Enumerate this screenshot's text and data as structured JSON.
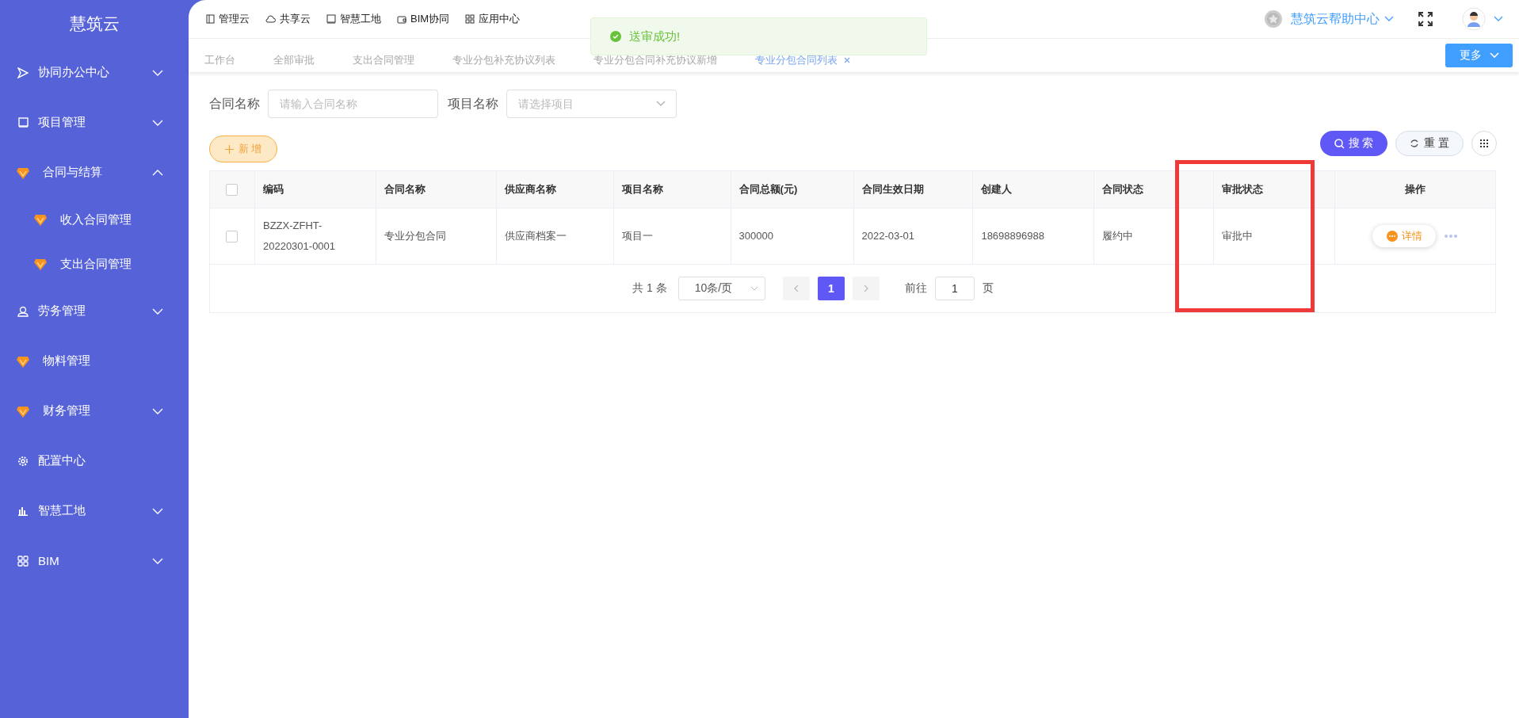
{
  "sidebar": {
    "logo": "慧筑云",
    "items": [
      {
        "label": "协同办公中心",
        "kind": "send",
        "expanded": false
      },
      {
        "label": "项目管理",
        "kind": "book",
        "expanded": false
      },
      {
        "label": "合同与结算",
        "kind": "gem",
        "expanded": true,
        "children": [
          {
            "label": "收入合同管理"
          },
          {
            "label": "支出合同管理"
          }
        ]
      },
      {
        "label": "劳务管理",
        "kind": "user",
        "expanded": false
      },
      {
        "label": "物料管理",
        "kind": "gem"
      },
      {
        "label": "财务管理",
        "kind": "gem",
        "expanded": false
      },
      {
        "label": "配置中心",
        "kind": "gear"
      },
      {
        "label": "智慧工地",
        "kind": "chart",
        "expanded": false
      },
      {
        "label": "BIM",
        "kind": "grid",
        "expanded": false
      }
    ]
  },
  "top_nav": [
    {
      "label": "管理云",
      "kind": "panel"
    },
    {
      "label": "共享云",
      "kind": "cloud"
    },
    {
      "label": "智慧工地",
      "kind": "book"
    },
    {
      "label": "BIM协同",
      "kind": "wallet"
    },
    {
      "label": "应用中心",
      "kind": "grid"
    }
  ],
  "help": {
    "label": "慧筑云帮助中心"
  },
  "tabs": [
    {
      "label": "工作台",
      "selected": false,
      "closable": false
    },
    {
      "label": "全部审批",
      "selected": false,
      "closable": false
    },
    {
      "label": "支出合同管理",
      "selected": false,
      "closable": false
    },
    {
      "label": "专业分包补充协议列表",
      "selected": false,
      "closable": false
    },
    {
      "label": "专业分包合同补充协议新增",
      "selected": false,
      "closable": false
    },
    {
      "label": "专业分包合同列表",
      "selected": true,
      "closable": true
    }
  ],
  "more_button": "更多",
  "toast": {
    "message": "送审成功!"
  },
  "filters": [
    {
      "label": "合同名称",
      "kind": "input",
      "placeholder": "请输入合同名称"
    },
    {
      "label": "项目名称",
      "kind": "select",
      "placeholder": "请选择项目"
    }
  ],
  "add_button": "新 增",
  "search_button": "搜 索",
  "reset_button": "重 置",
  "table": {
    "all_checked": false,
    "columns": [
      "编码",
      "合同名称",
      "供应商名称",
      "项目名称",
      "合同总额(元)",
      "合同生效日期",
      "创建人",
      "合同状态",
      "审批状态",
      "操作"
    ],
    "rows": [
      {
        "checked": false,
        "cells": [
          "BZZX-ZFHT-20220301-0001",
          "专业分包合同",
          "供应商档案一",
          "项目一",
          "300000",
          "2022-03-01",
          "18698896988",
          "履约中",
          "审批中"
        ],
        "action": "详情"
      }
    ]
  },
  "pagination": {
    "total": "共 1 条",
    "page_size": "10条/页",
    "pages": [
      {
        "label": "1",
        "selected": true
      }
    ],
    "goto_label": "前往",
    "goto_value": "1",
    "goto_suffix": "页"
  }
}
